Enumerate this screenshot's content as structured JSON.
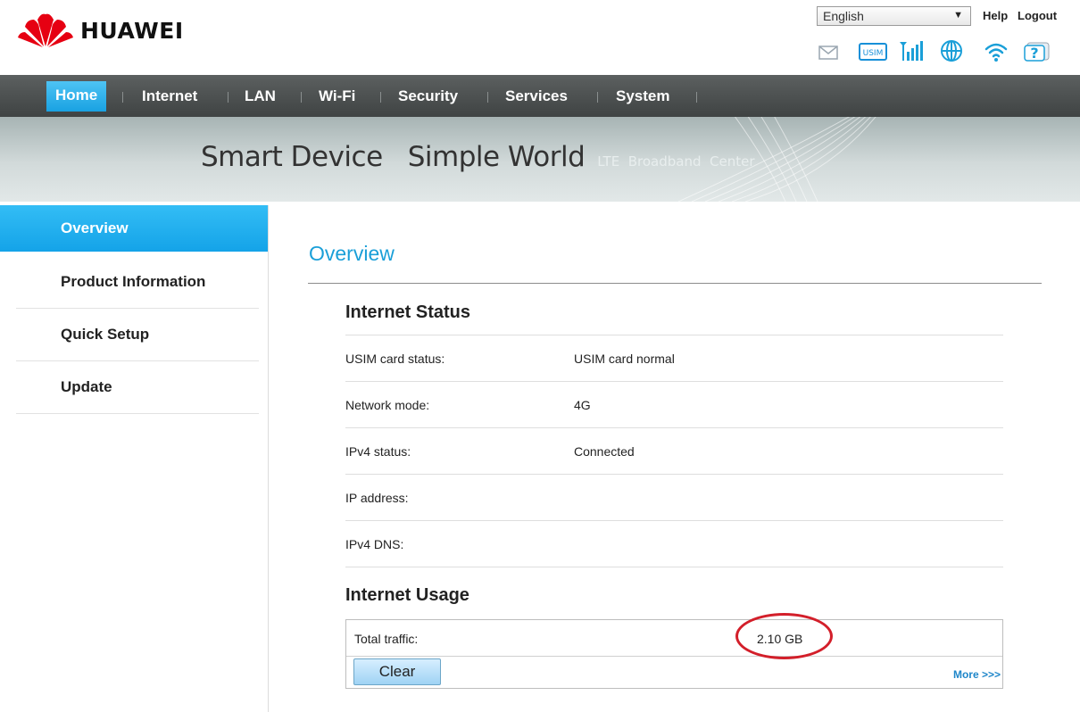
{
  "header": {
    "brand": "HUAWEI",
    "language": "English",
    "help": "Help",
    "logout": "Logout",
    "status_icons": [
      "envelope-icon",
      "usim-icon",
      "signal-icon",
      "globe-icon",
      "wifi-icon",
      "help-icon"
    ],
    "usim_text": "USIM"
  },
  "nav": {
    "items": [
      "Home",
      "Internet",
      "LAN",
      "Wi-Fi",
      "Security",
      "Services",
      "System"
    ],
    "active": "Home"
  },
  "banner": {
    "main": "Smart Device   Simple World",
    "sub": "LTE  Broadband  Center"
  },
  "sidebar": {
    "items": [
      "Overview",
      "Product Information",
      "Quick Setup",
      "Update"
    ],
    "active": "Overview"
  },
  "main": {
    "title": "Overview",
    "internet_status": {
      "title": "Internet Status",
      "rows": [
        {
          "label": "USIM card status:",
          "value": "USIM card normal"
        },
        {
          "label": "Network mode:",
          "value": "4G"
        },
        {
          "label": "IPv4 status:",
          "value": "Connected"
        },
        {
          "label": "IP address:",
          "value": ""
        },
        {
          "label": "IPv4 DNS:",
          "value": ""
        }
      ]
    },
    "internet_usage": {
      "title": "Internet Usage",
      "label": "Total traffic:",
      "value": "2.10 GB",
      "clear": "Clear",
      "more": "More >>>"
    }
  },
  "colors": {
    "accent": "#1a9fd8",
    "nav_bg": "#4a4f4f",
    "annotation": "#d31f2a",
    "brand_red": "#e60012"
  }
}
